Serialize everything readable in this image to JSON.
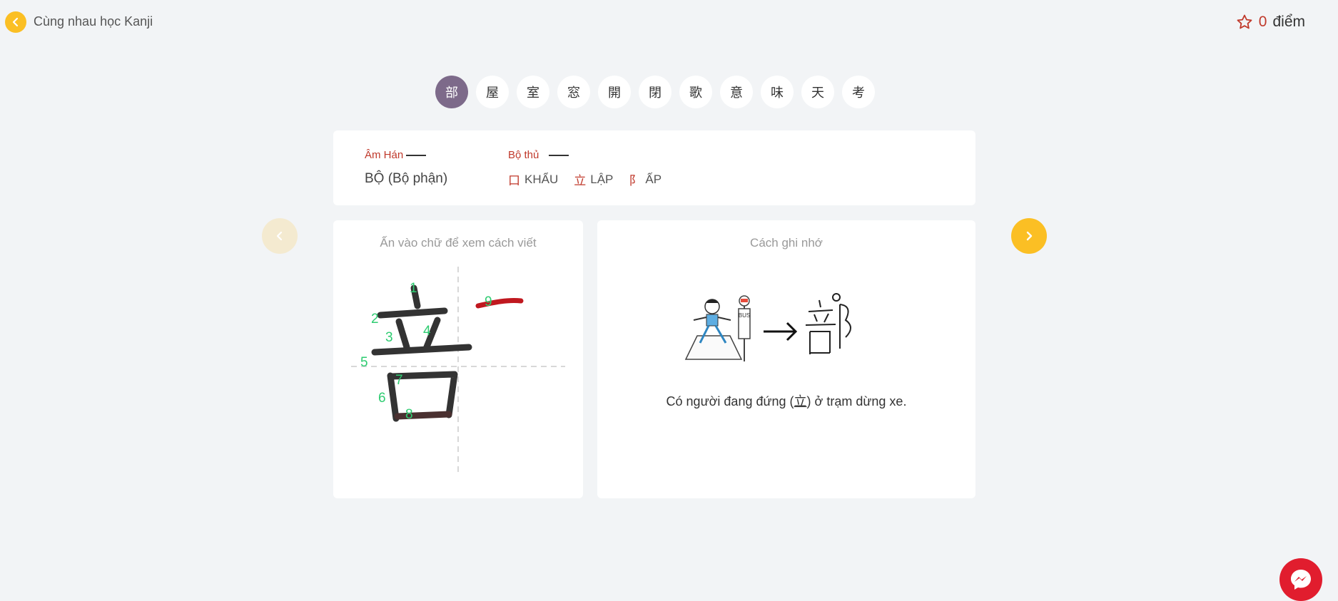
{
  "header": {
    "title": "Cùng nhau học Kanji",
    "score_value": "0",
    "score_unit": "điểm"
  },
  "kanji_tabs": [
    "部",
    "屋",
    "室",
    "窓",
    "開",
    "閉",
    "歌",
    "意",
    "味",
    "天",
    "考"
  ],
  "active_tab": 0,
  "info": {
    "am_han_label": "Âm Hán",
    "am_han_value": "BỘ (Bộ phận)",
    "bo_thu_label": "Bộ thủ",
    "radicals": [
      {
        "glyph": "口",
        "name": "KHẨU"
      },
      {
        "glyph": "立",
        "name": "LẬP"
      },
      {
        "glyph": "阝",
        "name": "ẤP"
      }
    ]
  },
  "stroke_card": {
    "caption": "Ấn vào chữ để xem cách viết",
    "stroke_numbers": [
      "1",
      "2",
      "3",
      "4",
      "5",
      "6",
      "7",
      "8",
      "9"
    ]
  },
  "memo_card": {
    "caption": "Cách ghi nhớ",
    "text_before": "Có người đang đứng (",
    "text_kanji": "立",
    "text_after": ") ở trạm dừng xe.",
    "bus_sign": "BUS",
    "result_kanji": "部"
  },
  "colors": {
    "accent": "#fbbf24",
    "active_tab": "#7d6a8a",
    "label_red": "#c0392b",
    "stroke_number_green": "#2ecc71",
    "messenger": "#e11d2e"
  }
}
